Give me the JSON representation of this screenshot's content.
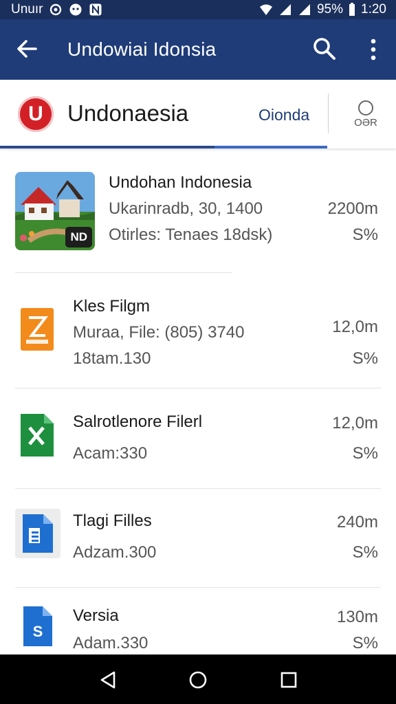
{
  "status_bar": {
    "carrier": "Unuır",
    "battery": "95%",
    "time": "1:20"
  },
  "app_bar": {
    "title": "Undowiai Idonsia",
    "icons": [
      "back-arrow-icon",
      "search-icon",
      "more-vert-icon"
    ]
  },
  "header": {
    "logo_letter": "U",
    "title": "Undonaesia",
    "link": "Oionda",
    "action_label": "OƏR",
    "colors": {
      "logo": "#d32027",
      "app_bar": "#1f3c78",
      "status_bar": "#1b2f5c"
    }
  },
  "files": [
    {
      "name": "Undohan Indonesia",
      "line1": "Ukarinradb, 30, 1400",
      "line2": "Otirles: Tenaes   18dsk)",
      "size": "2200m",
      "percent": "S%",
      "thumb": "photo",
      "badge": "ND"
    },
    {
      "name": "Kles Filgm",
      "line1": "Muraa, File: (805) 3740",
      "line2": "18tam.130",
      "size": "12,0m",
      "percent": "S%",
      "thumb": "zip-icon"
    },
    {
      "name": "Salrotlenore Filerl",
      "line1": "Acam:330",
      "size": "12,0m",
      "percent": "S%",
      "thumb": "excel-icon"
    },
    {
      "name": "Tlagi Filles",
      "line1": "Adzam.300",
      "size": "240m",
      "percent": "S%",
      "thumb": "doc-icon"
    },
    {
      "name": "Versia",
      "line1": "Adam.330",
      "size": "130m",
      "percent": "S%",
      "thumb": "sheet-s-icon"
    }
  ]
}
